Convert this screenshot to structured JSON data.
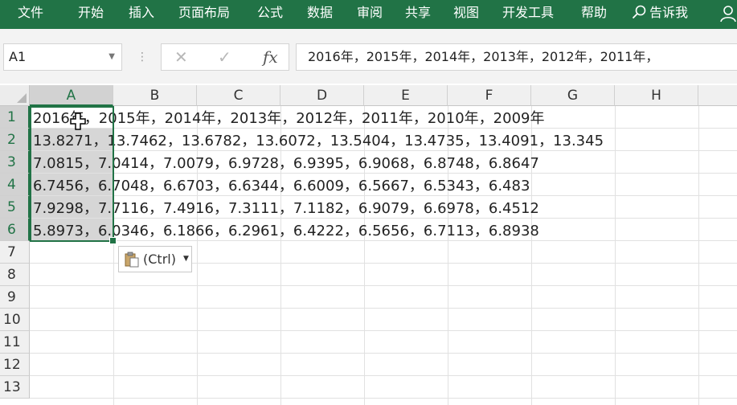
{
  "ribbon": {
    "tabs": [
      "文件",
      "开始",
      "插入",
      "页面布局",
      "公式",
      "数据",
      "审阅",
      "共享",
      "视图",
      "开发工具",
      "帮助"
    ],
    "tell_me": "告诉我"
  },
  "formula_bar": {
    "name_box": "A1",
    "cancel": "✕",
    "enter": "✓",
    "fx": "fx",
    "value": "2016年，2015年，2014年，2013年，2012年，2011年，"
  },
  "grid": {
    "columns": [
      "A",
      "B",
      "C",
      "D",
      "E",
      "F",
      "G",
      "H"
    ],
    "rows": [
      "1",
      "2",
      "3",
      "4",
      "5",
      "6",
      "7",
      "8",
      "9",
      "10",
      "11",
      "12",
      "13"
    ],
    "cell_values": [
      "2016年，2015年，2014年，2013年，2012年，2011年，2010年，2009年",
      "13.8271，13.7462，13.6782，13.6072，13.5404，13.4735，13.4091，13.345",
      "7.0815，7.0414，7.0079，6.9728，6.9395，6.9068，6.8748，6.8647",
      "6.7456，6.7048，6.6703，6.6344，6.6009，6.5667，6.5343，6.483",
      "7.9298，7.7116，7.4916，7.3111，7.1182，6.9079，6.6978，6.4512",
      "5.8973，6.0346，6.1866，6.2961，6.4222，6.5656，6.7113，6.8938"
    ]
  },
  "paste_options": {
    "label": "(Ctrl)"
  },
  "colors": {
    "accent": "#217346",
    "selection": "#d6d6d6"
  }
}
